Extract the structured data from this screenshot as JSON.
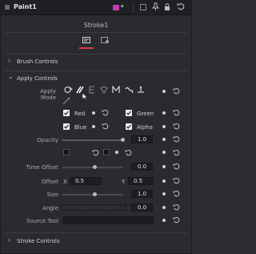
{
  "window": {
    "title": "Paint1",
    "title_label": "Stroke1"
  },
  "sections": {
    "brush": "Brush Controls",
    "apply": "Apply Controls",
    "stroke": "Stroke Controls"
  },
  "apply": {
    "apply_mode_label": "Apply Mode",
    "channels": {
      "red": "Red",
      "green": "Green",
      "blue": "Blue",
      "alpha": "Alpha"
    },
    "opacity": {
      "label": "Opacity",
      "value": "1.0"
    },
    "time_offset": {
      "label": "Time Offset",
      "value": "0.0"
    },
    "offset": {
      "label": "Offset",
      "x_label": "X",
      "x_value": "0.5",
      "y_label": "Y",
      "y_value": "0.5"
    },
    "size": {
      "label": "Size",
      "value": "1.0"
    },
    "angle": {
      "label": "Angle",
      "value": "0.0"
    },
    "source_tool": {
      "label": "Source Tool"
    }
  },
  "colors": {
    "accent_red": "#e0393e",
    "panel_bg": "#2a2b2f"
  }
}
